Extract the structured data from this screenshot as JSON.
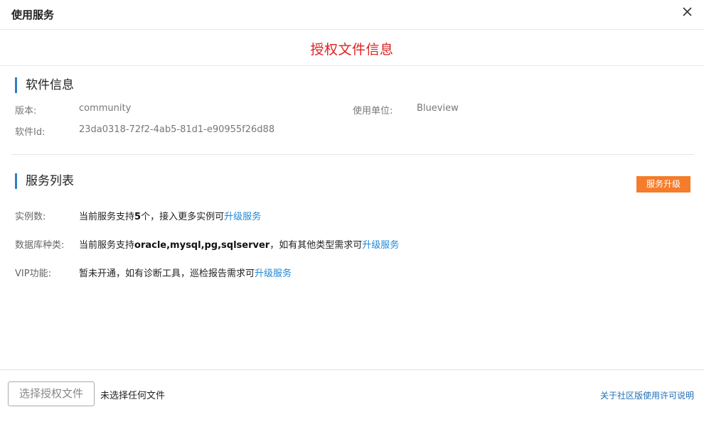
{
  "header": {
    "title": "使用服务",
    "close_icon": "close-icon"
  },
  "banner": {
    "title": "授权文件信息"
  },
  "software_info": {
    "heading": "软件信息",
    "version_label": "版本:",
    "version_value": "community",
    "unit_label": "使用单位:",
    "unit_value": "Blueview",
    "id_label": "软件Id:",
    "id_value": "23da0318-72f2-4ab5-81d1-e90955f26d88"
  },
  "service_list": {
    "heading": "服务列表",
    "upgrade_button": "服务升级",
    "upgrade_button_color": "#f57c2a",
    "rows": [
      {
        "label": "实例数:",
        "text_before": "当前服务支持",
        "bold": "5",
        "text_after": "个，接入更多实例可",
        "link": "升级服务"
      },
      {
        "label": "数据库种类:",
        "text_before": "当前服务支持",
        "bold": "oracle,mysql,pg,sqlserver",
        "text_after": "，如有其他类型需求可",
        "link": "升级服务"
      },
      {
        "label": "VIP功能:",
        "text_before": "暂未开通，如有诊断工具，巡检报告需求可",
        "bold": "",
        "text_after": "",
        "link": "升级服务"
      }
    ]
  },
  "footer": {
    "choose_file_button": "选择授权文件",
    "file_status": "未选择任何文件",
    "license_link": "关于社区版使用许可说明"
  },
  "colors": {
    "accent_red": "#e02020",
    "link_blue": "#1e88d8",
    "section_bar": "#2f7fc8"
  }
}
